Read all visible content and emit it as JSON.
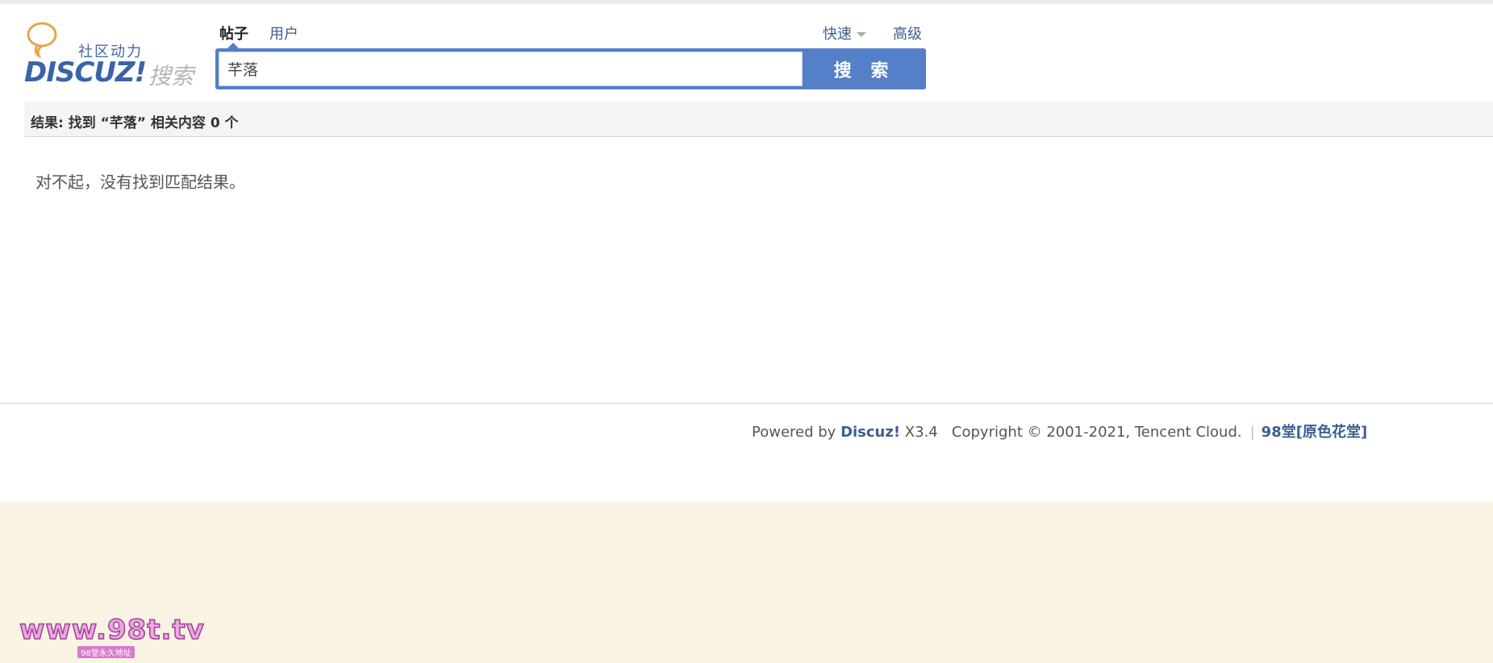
{
  "logo": {
    "tagline": "社区动力",
    "brand": "DISCUZ!",
    "subtitle": "搜索"
  },
  "tabs": [
    {
      "label": "帖子",
      "active": true
    },
    {
      "label": "用户",
      "active": false
    }
  ],
  "quick_label": "快速",
  "advanced_label": "高级",
  "search": {
    "value": "芊落",
    "button_label": "搜 索"
  },
  "results": {
    "summary": "结果: 找到 “芊落” 相关内容 0 个",
    "empty_message": "对不起，没有找到匹配结果。"
  },
  "footer": {
    "powered_prefix": "Powered by ",
    "powered_brand": "Discuz!",
    "version": " X3.4",
    "copyright": "Copyright © 2001-2021, Tencent Cloud.",
    "separator": "|",
    "site_name": "98堂[原色花堂]"
  },
  "watermark": {
    "url": "www.98t.tv",
    "note": "98堂永久地址"
  },
  "colors": {
    "accent": "#5380c8",
    "link": "#3d5e92",
    "bottom_bg": "#f8f3e2"
  }
}
